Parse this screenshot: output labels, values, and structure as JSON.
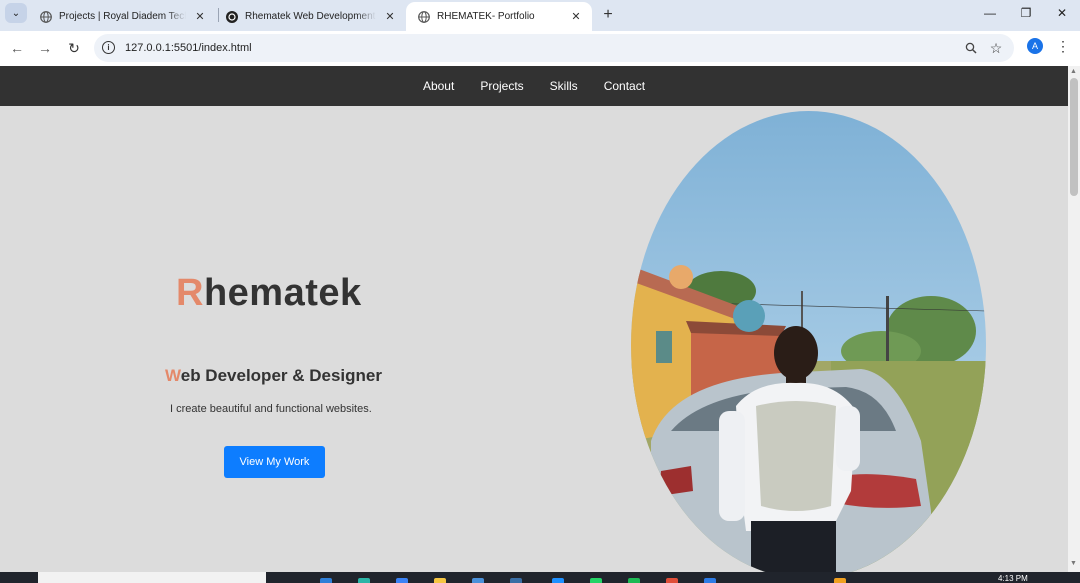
{
  "browser": {
    "tabs": [
      {
        "title": "Projects | Royal Diadem Tech",
        "active": false
      },
      {
        "title": "Rhematek Web Development C",
        "active": false
      },
      {
        "title": "RHEMATEK- Portfolio",
        "active": true
      }
    ],
    "url": "127.0.0.1:5501/index.html",
    "profile_initial": "A",
    "icons": {
      "tab_search": "chevron-down-icon",
      "back": "arrow-left-icon",
      "forward": "arrow-right-icon",
      "reload": "reload-icon",
      "site_info": "info-icon",
      "zoom": "zoom-icon",
      "bookmark": "star-icon",
      "menu": "more-vertical-icon",
      "new_tab": "plus-icon",
      "close_tab": "close-icon"
    },
    "glyphs": {
      "tab_search": "⌄",
      "back": "←",
      "forward": "→",
      "reload": "↻",
      "site_info": "i",
      "zoom": "⊕",
      "bookmark": "☆",
      "menu": "⋮",
      "new_tab": "+",
      "close": "✕",
      "minimize": "—",
      "restore": "❐",
      "window_close": "✕",
      "scroll_up": "▲",
      "scroll_down": "▼"
    }
  },
  "site": {
    "nav": [
      "About",
      "Projects",
      "Skills",
      "Contact"
    ],
    "hero": {
      "title_accent": "R",
      "title_rest": "hematek",
      "subtitle_accent": "W",
      "subtitle_rest": "eb Developer & Designer",
      "description": "I create beautiful and functional websites.",
      "cta_label": "View My Work"
    },
    "colors": {
      "nav_bg": "#323232",
      "page_bg": "#dcdcdc",
      "accent": "#e4896a",
      "button": "#0d7dff",
      "text": "#333333"
    }
  },
  "taskbar": {
    "time": "4:13 PM"
  }
}
